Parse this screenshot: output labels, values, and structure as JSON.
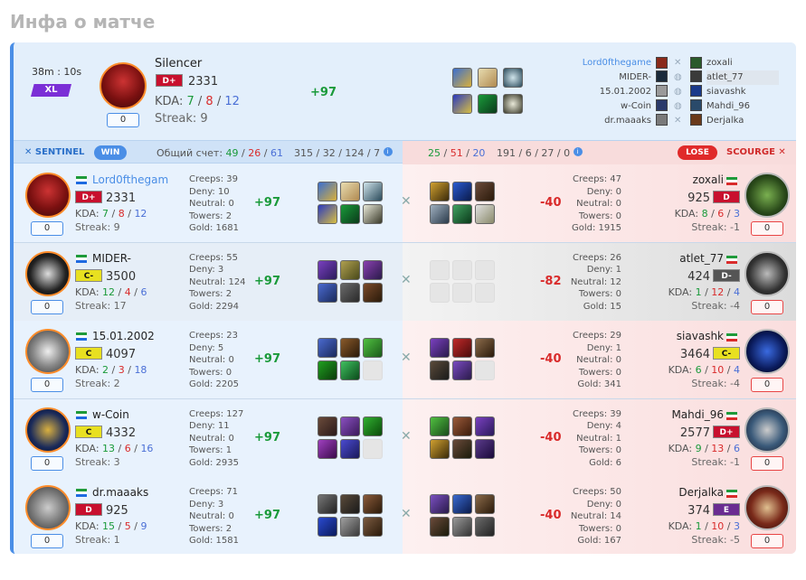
{
  "page_title": "Инфа о матче",
  "summary": {
    "duration": "38m : 10s",
    "badge": "XL",
    "hero": {
      "name": "Silencer",
      "rank": "D+",
      "rating": "2331",
      "kda_k": "7",
      "kda_d": "8",
      "kda_a": "12",
      "streak": "Streak: 9",
      "delta": "+97",
      "counter": "0"
    },
    "players_left": [
      "Lord0fthegame",
      "MIDER-",
      "15.01.2002",
      "w-Coin",
      "dr.maaaks"
    ],
    "players_right": [
      "zoxali",
      "atlet_77",
      "siavashk",
      "Mahdi_96",
      "Derjalka"
    ]
  },
  "teambar": {
    "sentinel": "SENTINEL",
    "win": "WIN",
    "score_label": "Общий счет:",
    "left_k": "49",
    "left_d": "26",
    "left_a": "61",
    "left_cs": "315 / 32 / 124 / 7",
    "right_k": "25",
    "right_d": "51",
    "right_a": "20",
    "right_cs": "191 / 6 / 27 / 0",
    "lose": "LOSE",
    "scourge": "SCOURGE",
    "sep": "/",
    "info": "i"
  },
  "rows": [
    {
      "left": {
        "name": "Lord0fthegam",
        "rank": "D+",
        "rating": "2331",
        "k": "7",
        "d": "8",
        "a": "12",
        "streak": "Streak: 9",
        "counter": "0",
        "creeps": "Creeps: 39",
        "deny": "Deny: 10",
        "neutral": "Neutral: 0",
        "towers": "Towers: 2",
        "gold": "Gold: 1681",
        "delta": "+97"
      },
      "right": {
        "name": "zoxali",
        "rank": "D",
        "rating": "925",
        "k": "8",
        "d": "6",
        "a": "3",
        "streak": "Streak: -1",
        "counter": "0",
        "creeps": "Creeps: 47",
        "deny": "Deny: 0",
        "neutral": "Neutral: 0",
        "towers": "Towers: 0",
        "gold": "Gold: 1915",
        "delta": "-40"
      }
    },
    {
      "left": {
        "name": "MIDER-",
        "rank": "C-",
        "rating": "3500",
        "k": "12",
        "d": "4",
        "a": "6",
        "streak": "Streak: 17",
        "counter": "0",
        "creeps": "Creeps: 55",
        "deny": "Deny: 3",
        "neutral": "Neutral: 124",
        "towers": "Towers: 2",
        "gold": "Gold: 2294",
        "delta": "+97"
      },
      "right": {
        "name": "atlet_77",
        "rank": "D-",
        "rating": "424",
        "k": "1",
        "d": "12",
        "a": "4",
        "streak": "Streak: -4",
        "counter": "0",
        "creeps": "Creeps: 26",
        "deny": "Deny: 1",
        "neutral": "Neutral: 12",
        "towers": "Towers: 0",
        "gold": "Gold: 15",
        "delta": "-82"
      }
    },
    {
      "left": {
        "name": "15.01.2002",
        "rank": "C",
        "rating": "4097",
        "k": "2",
        "d": "3",
        "a": "18",
        "streak": "Streak: 2",
        "counter": "0",
        "creeps": "Creeps: 23",
        "deny": "Deny: 5",
        "neutral": "Neutral: 0",
        "towers": "Towers: 0",
        "gold": "Gold: 2205",
        "delta": "+97"
      },
      "right": {
        "name": "siavashk",
        "rank": "C-",
        "rating": "3464",
        "k": "6",
        "d": "10",
        "a": "4",
        "streak": "Streak: -4",
        "counter": "0",
        "creeps": "Creeps: 29",
        "deny": "Deny: 1",
        "neutral": "Neutral: 0",
        "towers": "Towers: 0",
        "gold": "Gold: 341",
        "delta": "-40"
      }
    },
    {
      "left": {
        "name": "w-Coin",
        "rank": "C",
        "rating": "4332",
        "k": "13",
        "d": "6",
        "a": "16",
        "streak": "Streak: 3",
        "counter": "0",
        "creeps": "Creeps: 127",
        "deny": "Deny: 11",
        "neutral": "Neutral: 0",
        "towers": "Towers: 1",
        "gold": "Gold: 2935",
        "delta": "+97"
      },
      "right": {
        "name": "Mahdi_96",
        "rank": "D+",
        "rating": "2577",
        "k": "9",
        "d": "13",
        "a": "6",
        "streak": "Streak: -1",
        "counter": "0",
        "creeps": "Creeps: 39",
        "deny": "Deny: 4",
        "neutral": "Neutral: 1",
        "towers": "Towers: 0",
        "gold": "Gold: 6",
        "delta": "-40"
      }
    },
    {
      "left": {
        "name": "dr.maaaks",
        "rank": "D",
        "rating": "925",
        "k": "15",
        "d": "5",
        "a": "9",
        "streak": "Streak: 1",
        "counter": "0",
        "creeps": "Creeps: 71",
        "deny": "Deny: 3",
        "neutral": "Neutral: 0",
        "towers": "Towers: 2",
        "gold": "Gold: 1581",
        "delta": "+97"
      },
      "right": {
        "name": "Derjalka",
        "rank": "E",
        "rating": "374",
        "k": "1",
        "d": "10",
        "a": "3",
        "streak": "Streak: -5",
        "counter": "0",
        "creeps": "Creeps: 50",
        "deny": "Deny: 0",
        "neutral": "Neutral: 14",
        "towers": "Towers: 0",
        "gold": "Gold: 167",
        "delta": "-40"
      }
    }
  ]
}
